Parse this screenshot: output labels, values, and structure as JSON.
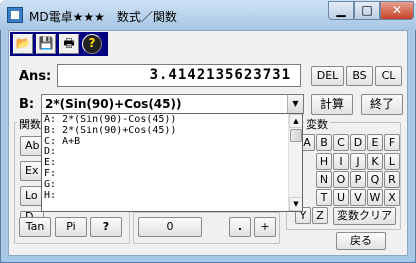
{
  "window": {
    "title": "MD電卓★★★　数式／関数",
    "min_glyph": "▁",
    "max_glyph": "□",
    "close_glyph": "✕"
  },
  "toolbar": [
    {
      "icon": "open-folder-icon",
      "glyph": "📂"
    },
    {
      "icon": "save-disk-icon",
      "glyph": "💾"
    },
    {
      "icon": "print-icon",
      "glyph": "🖶"
    },
    {
      "icon": "help-icon",
      "glyph": "?"
    }
  ],
  "ans": {
    "label": "Ans:",
    "value": "3.4142135623731"
  },
  "ans_buttons": {
    "del": "DEL",
    "bs": "BS",
    "cl": "CL"
  },
  "expr": {
    "label": "B:",
    "value": "2*(Sin(90)+Cos(45))",
    "calc_button": "計算",
    "exit_button": "終了"
  },
  "dropdown": {
    "items": [
      "A: 2*(Sin(90)-Cos(45))",
      "B: 2*(Sin(90)+Cos(45))",
      "C: A+B",
      "D:",
      "E:",
      "F:",
      "G:",
      "H:"
    ]
  },
  "func_group": {
    "title": "関数",
    "visible_fragments": [
      "Ab",
      "Ex",
      "Lo",
      "D"
    ],
    "bottom_buttons": [
      "Tan",
      "Pi",
      "?"
    ]
  },
  "num_group": {
    "buttons": [
      "0",
      ".",
      "+"
    ]
  },
  "var_group": {
    "title": "変数",
    "keys": [
      [
        "A",
        "B",
        "C",
        "D",
        "E",
        "F"
      ],
      [
        "H",
        "I",
        "J",
        "K",
        "L"
      ],
      [
        "N",
        "O",
        "P",
        "Q",
        "R"
      ],
      [
        "T",
        "U",
        "V",
        "W",
        "X"
      ],
      [
        "Y",
        "Z"
      ]
    ],
    "clear_button": "変数クリア"
  },
  "back_button": "戻る"
}
